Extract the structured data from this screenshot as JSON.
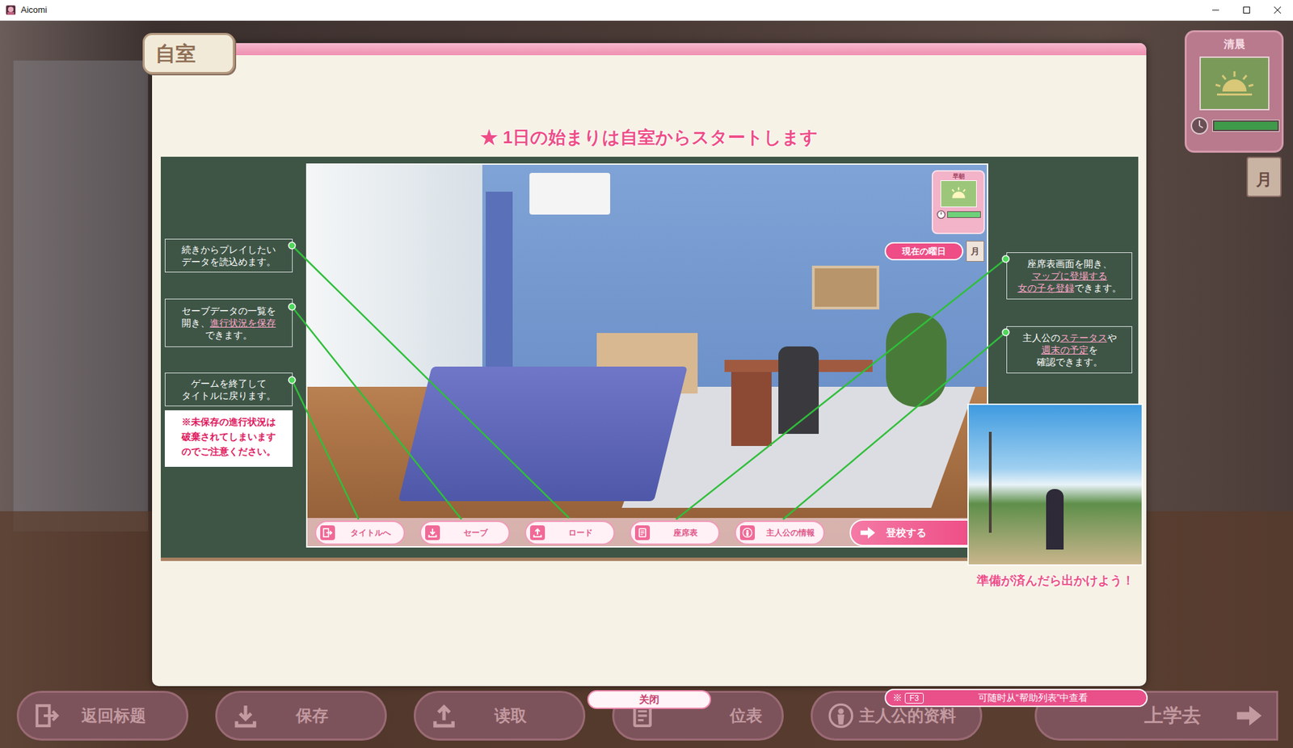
{
  "window": {
    "title": "Aicomi"
  },
  "clock": {
    "period": "清晨",
    "level": 1,
    "weekday": "月"
  },
  "bottom_bar": [
    {
      "label": "返回标题",
      "kind": "exit"
    },
    {
      "label": "保存",
      "kind": "save"
    },
    {
      "label": "读取",
      "kind": "load"
    },
    {
      "label": "位表",
      "kind": "seat"
    },
    {
      "label": "主人公的资料",
      "kind": "info"
    },
    {
      "label": "上学去",
      "kind": "go"
    }
  ],
  "help": {
    "tab": "自室",
    "heading": "★ 1日の始まりは自室からスタートします",
    "left_notes": [
      {
        "lines": [
          [
            {
              "text": "続きからプレイしたい",
              "highlight": false
            }
          ],
          [
            {
              "text": "データを読込めます。",
              "highlight": false
            }
          ]
        ]
      },
      {
        "lines": [
          [
            {
              "text": "セーブデータの一覧を",
              "highlight": false
            }
          ],
          [
            {
              "text": "開き、",
              "highlight": false
            },
            {
              "text": "進行状況を保存",
              "highlight": true
            }
          ],
          [
            {
              "text": "できます。",
              "highlight": false
            }
          ]
        ]
      },
      {
        "lines": [
          [
            {
              "text": "ゲームを終了して",
              "highlight": false
            }
          ],
          [
            {
              "text": "タイトルに戻ります。",
              "highlight": false
            }
          ]
        ]
      }
    ],
    "warning": [
      "※未保存の進行状況は",
      "破棄されてしまいます",
      "のでご注意ください。"
    ],
    "right_notes": [
      {
        "lines": [
          [
            {
              "text": "座席表画面を開き、",
              "highlight": false
            }
          ],
          [
            {
              "text": "マップに登場する",
              "highlight": true
            }
          ],
          [
            {
              "text": "女の子を登録",
              "highlight": true
            },
            {
              "text": "できます。",
              "highlight": false
            }
          ]
        ]
      },
      {
        "lines": [
          [
            {
              "text": "主人公の",
              "highlight": false
            },
            {
              "text": "ステータス",
              "highlight": true
            },
            {
              "text": "や",
              "highlight": false
            }
          ],
          [
            {
              "text": "週末の予定",
              "highlight": true
            },
            {
              "text": "を",
              "highlight": false
            }
          ],
          [
            {
              "text": "確認できます。",
              "highlight": false
            }
          ]
        ]
      }
    ],
    "preview": {
      "period": "早朝",
      "level": 1,
      "weekday_label": "現在の曜日",
      "weekday": "月",
      "buttons": [
        {
          "label": "タイトルへ",
          "kind": "exit"
        },
        {
          "label": "セーブ",
          "kind": "save"
        },
        {
          "label": "ロード",
          "kind": "load"
        },
        {
          "label": "座席表",
          "kind": "seat"
        },
        {
          "label": "主人公の情報",
          "kind": "info"
        }
      ],
      "go": "登校する"
    },
    "photo_caption": "準備が済んだら出かけよう！",
    "close": "关闭"
  },
  "hint": {
    "prefix": "※",
    "key": "F3",
    "text": "可随时从“帮助列表”中查看"
  }
}
